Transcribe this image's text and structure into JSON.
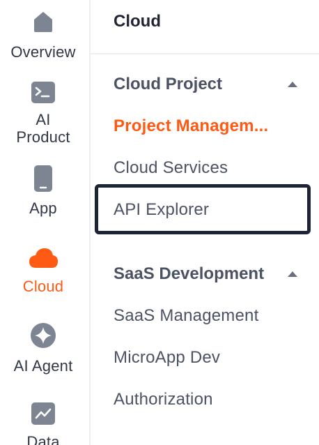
{
  "sidebar": {
    "items": [
      {
        "id": "overview",
        "label": "Overview",
        "icon": "home-icon",
        "active": false
      },
      {
        "id": "ai-product",
        "label": "AI Product",
        "icon": "terminal-icon",
        "active": false
      },
      {
        "id": "app",
        "label": "App",
        "icon": "phone-icon",
        "active": false
      },
      {
        "id": "cloud",
        "label": "Cloud",
        "icon": "cloud-icon",
        "active": true
      },
      {
        "id": "ai-agent",
        "label": "AI Agent",
        "icon": "sparkle-icon",
        "active": false
      },
      {
        "id": "data",
        "label": "Data",
        "icon": "chart-icon",
        "active": false
      }
    ]
  },
  "panel": {
    "title": "Cloud",
    "groups": [
      {
        "title": "Cloud Project",
        "expanded": true,
        "items": [
          {
            "label": "Project Managem...",
            "active": true
          },
          {
            "label": "Cloud Services",
            "active": false
          },
          {
            "label": "API Explorer",
            "active": false,
            "highlighted": true
          }
        ]
      },
      {
        "title": "SaaS Development",
        "expanded": true,
        "items": [
          {
            "label": "SaaS Management",
            "active": false
          },
          {
            "label": "MicroApp Dev",
            "active": false
          },
          {
            "label": "Authorization",
            "active": false
          }
        ]
      }
    ]
  },
  "colors": {
    "accent": "#ff5a14",
    "text": "#4a5264",
    "title": "#1f2533",
    "icon_gray": "#7d8592",
    "highlight_border": "#1c2436",
    "divider": "#eceef2"
  }
}
